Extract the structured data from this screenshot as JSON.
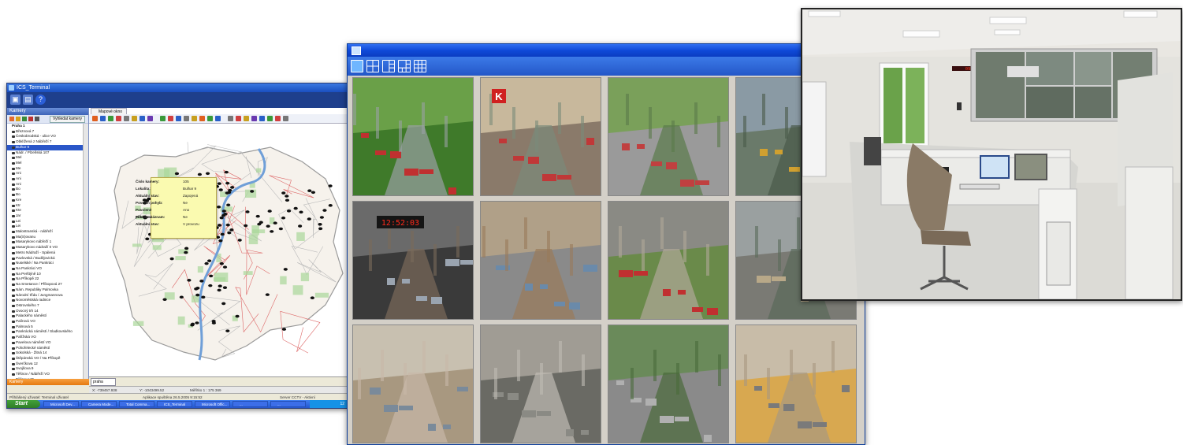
{
  "map_window": {
    "title": "ICS_Terminal",
    "panel_header": "Kamery",
    "tool_button": "Vyhledat kamery",
    "map_tab": "Mapové okno",
    "tree_root": "Praha 1",
    "tree_items": [
      "Březnová 7",
      "Českobrodská - ulice VO",
      "Obklížená z Nábřeží 7",
      "Bulhar 9",
      "Nádr. / Plzeňská 107",
      "Mel",
      "Mel",
      "Me",
      "Ani",
      "Ani",
      "Ani",
      "Bo",
      "Bo",
      "Kre",
      "Ktr",
      "Kte",
      "Jar",
      "Lei",
      "Lei",
      "Malostranská - nábřeží",
      "Ma(S)ovanu",
      "Masarykovo nábřeží 1",
      "Masarykovo nádraží 0 VO",
      "Metro Nádraží - Spálená",
      "Pavlovská / Budějovická",
      "Nuselské / Na Pankráci",
      "Na Pankráci VO",
      "Na Perštýně 10",
      "Na Příkopě 22",
      "Na Smetance / Příkopová 27",
      "Nám. Republiky Palmovka",
      "Národní třída / Jungmannova",
      "Novoměstská radnice",
      "Ostrovského 7",
      "Ovocný trh 14",
      "Palackého náměstí",
      "Palírová VO",
      "Palmová 5",
      "Pankrácká náměstí / Sladkovského",
      "Pařížská VO",
      "Pavelova náměstí VO",
      "Pohořelecké náměstí",
      "Sokolská - Žitná 14",
      "Štěpánská VO / Na Příkopě",
      "Šverčkova 12",
      "Svojšova 9",
      "Těšnov / Nábřeží VO",
      "Těšnov VO",
      "Týnská",
      "Vyšehradská - hlavní",
      "Václavské náměstí 16"
    ],
    "selected_item": "Bulhar 9",
    "tooltip": [
      {
        "label": "Číslo kamery:",
        "value": "105"
      },
      {
        "label": "Lokalita:",
        "value": "Bulhar 9"
      },
      {
        "label": "Aktuální stav:",
        "value": "Zapojená"
      },
      {
        "label": "Povolen pohyb:",
        "value": "Ne"
      },
      {
        "label": "Povolené přiblížení:",
        "value": "Ano"
      },
      {
        "label": "Povolen záznam:",
        "value": "Ne"
      },
      {
        "label": "Aktuální stav:",
        "value": "V provozu"
      }
    ],
    "search_value": "praha",
    "coords": {
      "x": "X: -739457.938",
      "y": "Y: -1043499.52",
      "scale": "Měřítko 1 : 175 369"
    },
    "footer": "Kamery",
    "status_left": "Přihlášený uživatel: Terminal uživatel",
    "status_mid": "Aplikace spuštěna 26.5.2005 9:15:52",
    "status_right": "Server CCTV - Aktivní",
    "taskbar_start": "Start",
    "taskbar_items": [
      "Microsoft Dev...",
      "Camera Mode...",
      "Total Comma...",
      "ICS_Terminal",
      "Microsoft Offic...",
      "...",
      "..."
    ],
    "tray_time": "12"
  },
  "grid_window": {
    "layouts": [
      "1x1",
      "2x2",
      "1+3",
      "1+5",
      "3x3"
    ],
    "cameras": [
      "market-stalls",
      "square-kiosk",
      "street-cars-trees",
      "tram-street",
      "metro-clock",
      "avenue-intersection",
      "street-crossing-overhead",
      "parked-cars-sidewalk",
      "building-corner",
      "wet-glass-street",
      "street-trees-cars",
      "arcade-pedestrians"
    ],
    "clock_display": "12:52:03",
    "kiosk_sign": "K"
  },
  "control_room": {
    "led_sign": "09:14:32"
  }
}
